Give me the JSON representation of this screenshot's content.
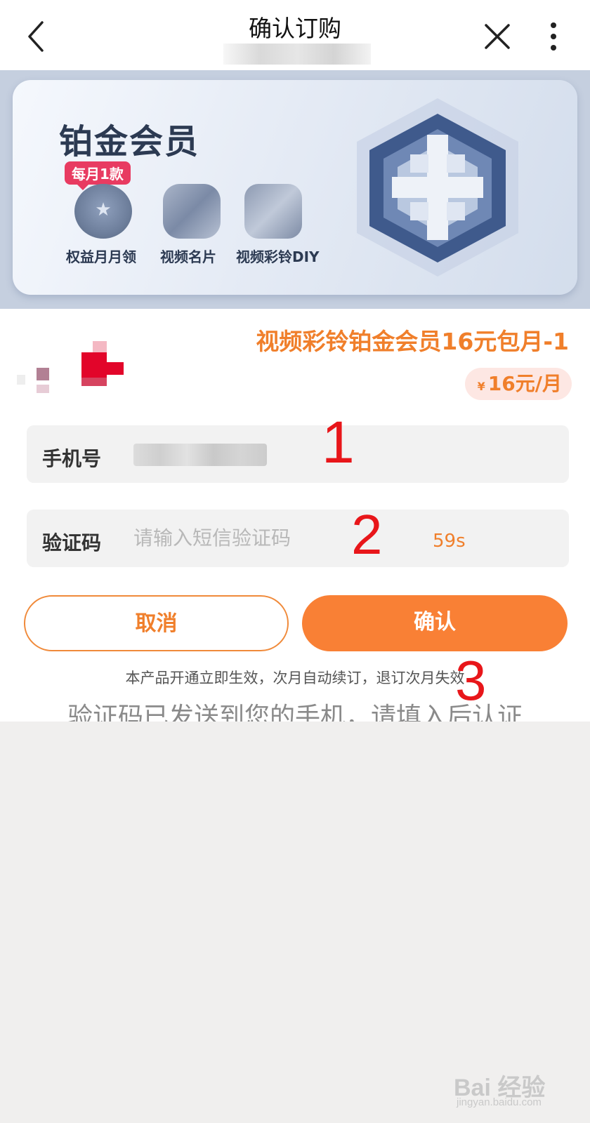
{
  "header": {
    "title": "确认订购"
  },
  "banner": {
    "title": "铂金会员",
    "badge": "每月1款",
    "benefits": [
      "权益月月领",
      "视频名片",
      "视频彩铃DIY"
    ]
  },
  "product": {
    "name": "视频彩铃铂金会员16元包月-1",
    "currency_symbol": "¥",
    "price": "16元/月"
  },
  "form": {
    "phone_label": "手机号",
    "code_label": "验证码",
    "code_placeholder": "请输入短信验证码",
    "countdown": "59s"
  },
  "buttons": {
    "cancel": "取消",
    "confirm": "确认"
  },
  "notice": "本产品开通立即生效，次月自动续订，退订次月失效",
  "message": "验证码已发送到您的手机，请填入后认证",
  "annotations": [
    "1",
    "2",
    "3"
  ],
  "watermark": {
    "text": "Bai 经验",
    "url": "jingyan.baidu.com"
  },
  "colors": {
    "accent": "#f98035",
    "title_orange": "#f07f2b",
    "annotation_red": "#e8161a"
  }
}
